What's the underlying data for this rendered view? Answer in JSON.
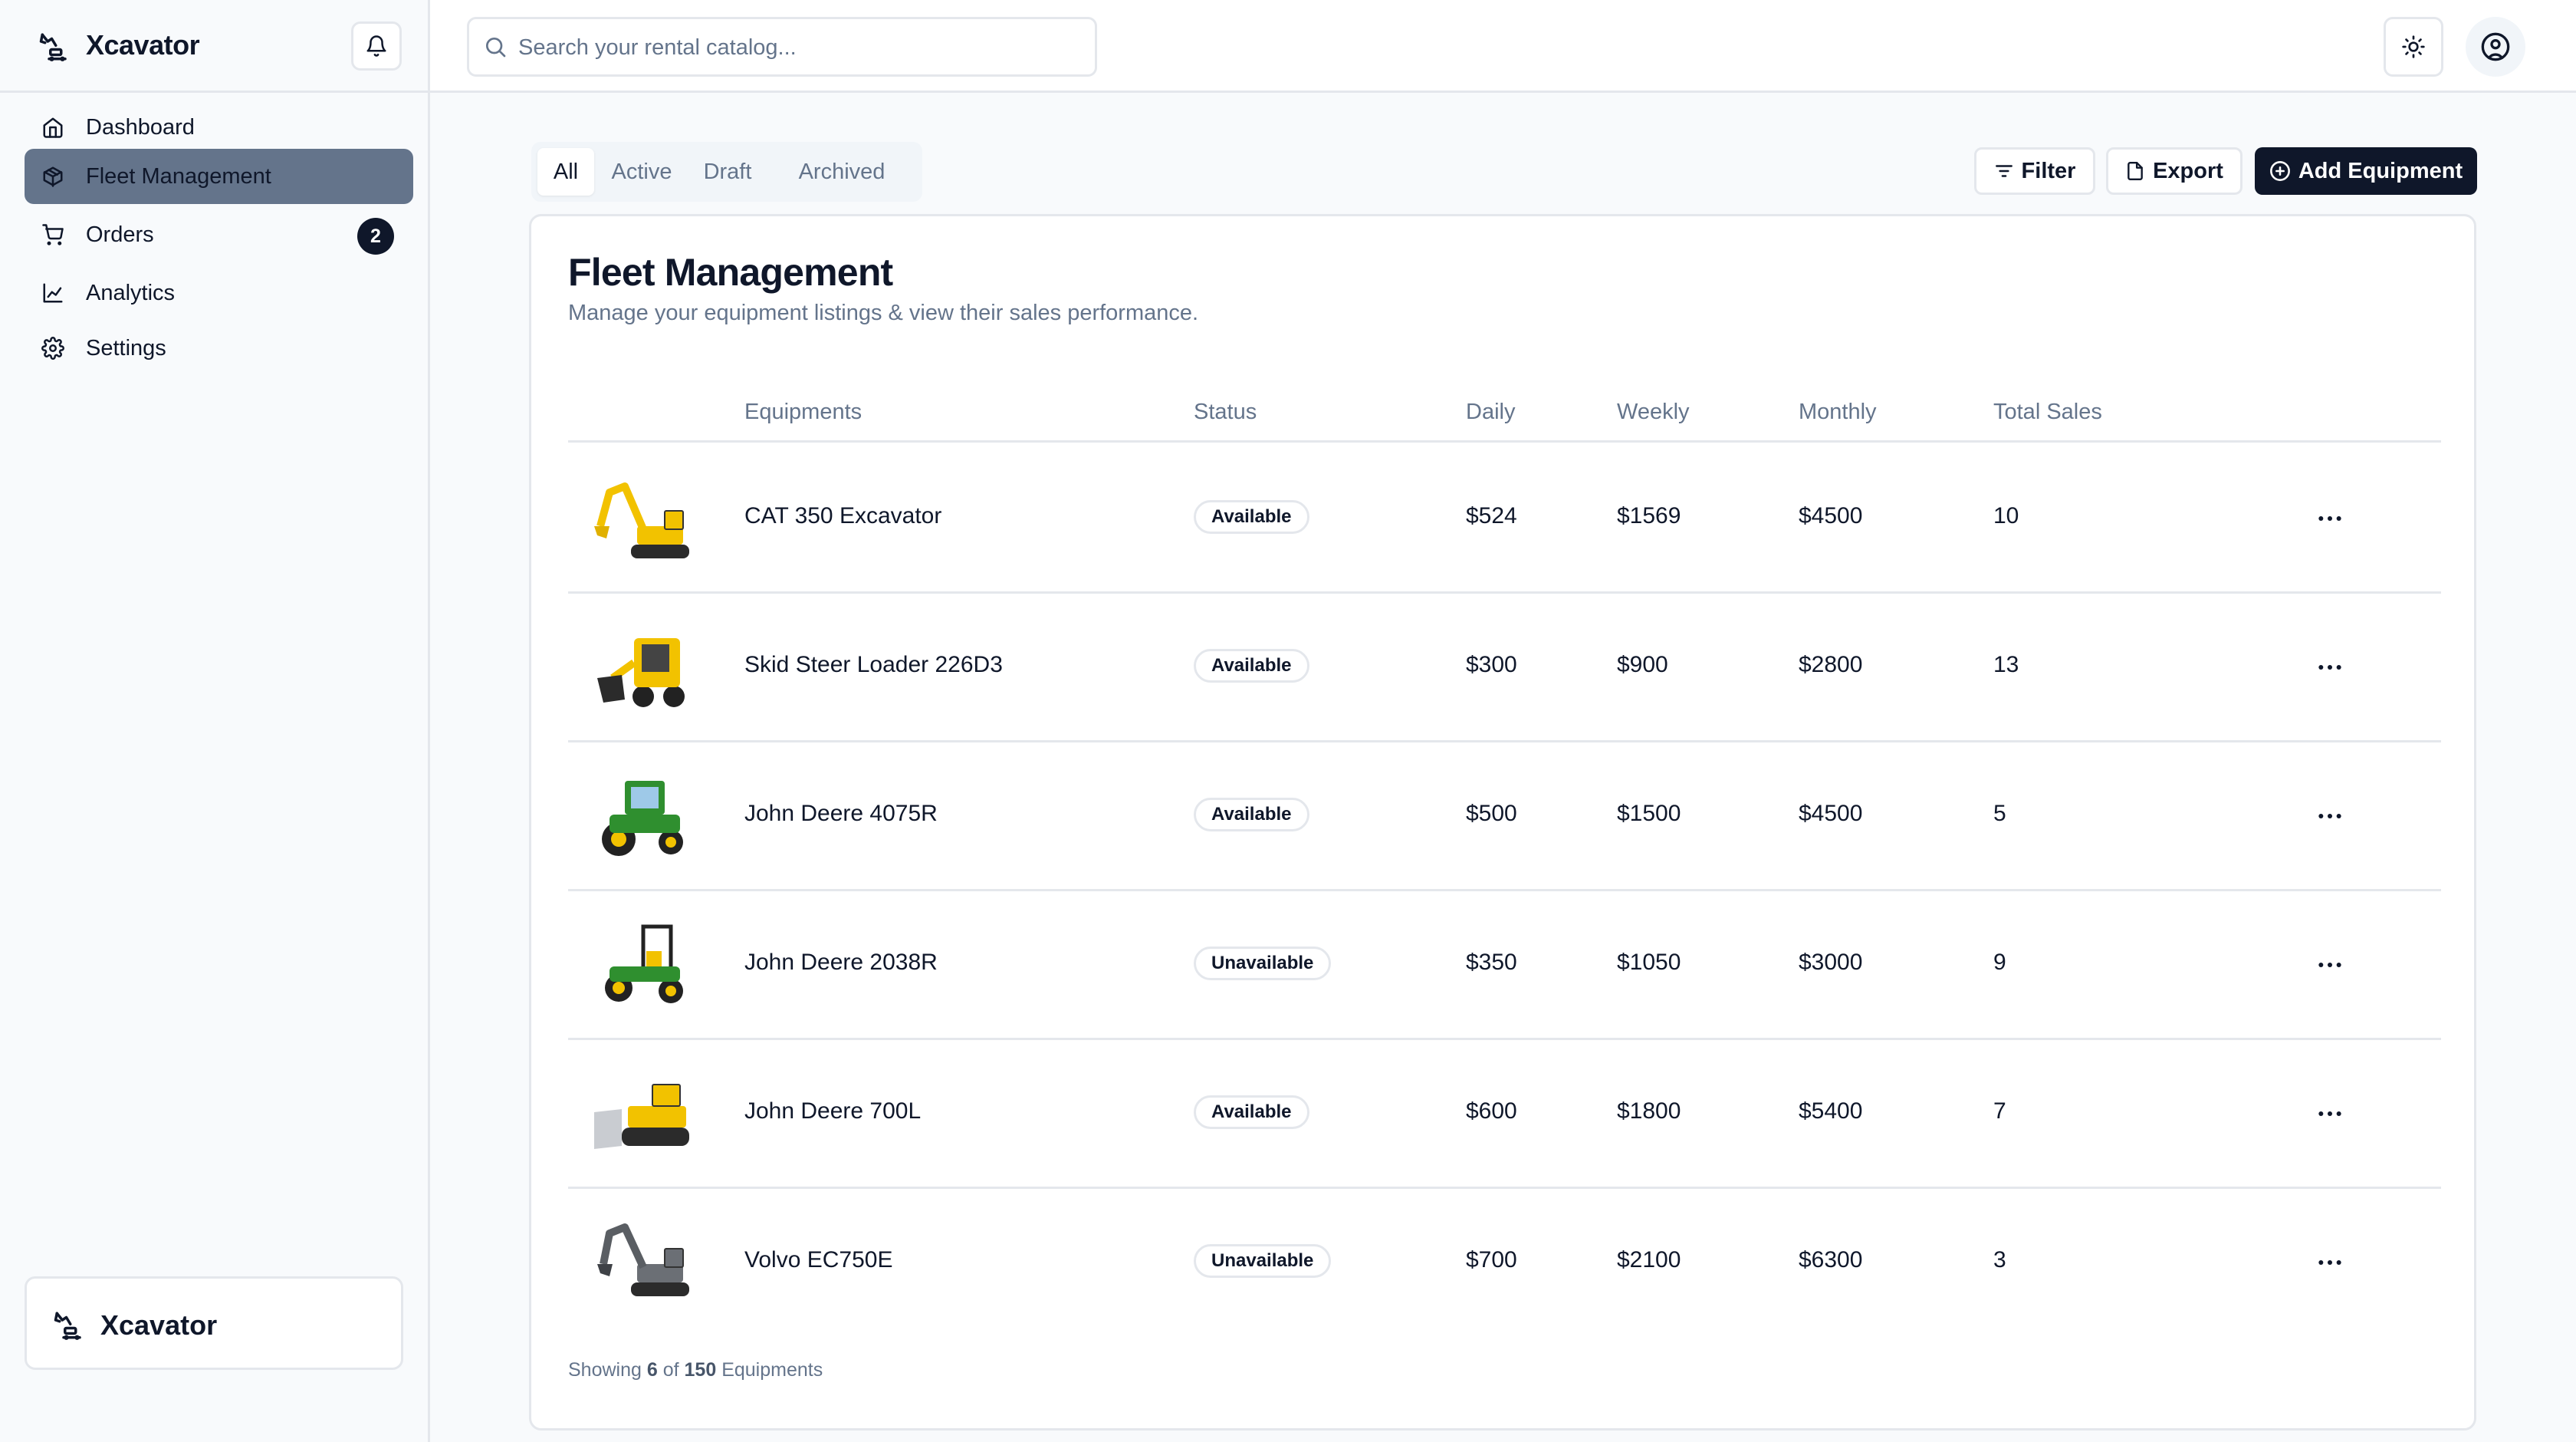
{
  "app": {
    "name": "Xcavator"
  },
  "sidebar": {
    "items": [
      {
        "label": "Dashboard",
        "icon": "home-icon",
        "active": false
      },
      {
        "label": "Fleet Management",
        "icon": "package-icon",
        "active": true
      },
      {
        "label": "Orders",
        "icon": "cart-icon",
        "active": false,
        "badge": "2"
      },
      {
        "label": "Analytics",
        "icon": "line-chart-icon",
        "active": false
      },
      {
        "label": "Settings",
        "icon": "gear-icon",
        "active": false
      }
    ],
    "footer_brand": "Xcavator"
  },
  "header": {
    "search_placeholder": "Search your rental catalog..."
  },
  "tabs": [
    "All",
    "Active",
    "Draft",
    "Archived"
  ],
  "toolbar": {
    "filter_label": "Filter",
    "export_label": "Export",
    "add_label": "Add Equipment"
  },
  "card": {
    "title": "Fleet Management",
    "subtitle": "Manage your equipment listings & view their sales performance."
  },
  "table": {
    "columns": [
      "Equipments",
      "Status",
      "Daily",
      "Weekly",
      "Monthly",
      "Total Sales"
    ],
    "rows": [
      {
        "name": "CAT 350 Excavator",
        "status": "Available",
        "daily": "$524",
        "weekly": "$1569",
        "monthly": "$4500",
        "total": "10",
        "thumb": "excavator-yellow"
      },
      {
        "name": "Skid Steer Loader 226D3",
        "status": "Available",
        "daily": "$300",
        "weekly": "$900",
        "monthly": "$2800",
        "total": "13",
        "thumb": "skid-steer"
      },
      {
        "name": "John Deere 4075R",
        "status": "Available",
        "daily": "$500",
        "weekly": "$1500",
        "monthly": "$4500",
        "total": "5",
        "thumb": "tractor-green"
      },
      {
        "name": "John Deere 2038R",
        "status": "Unavailable",
        "daily": "$350",
        "weekly": "$1050",
        "monthly": "$3000",
        "total": "9",
        "thumb": "tractor-green-small"
      },
      {
        "name": "John Deere 700L",
        "status": "Available",
        "daily": "$600",
        "weekly": "$1800",
        "monthly": "$5400",
        "total": "7",
        "thumb": "dozer-yellow"
      },
      {
        "name": "Volvo EC750E",
        "status": "Unavailable",
        "daily": "$700",
        "weekly": "$2100",
        "monthly": "$6300",
        "total": "3",
        "thumb": "excavator-gray"
      }
    ]
  },
  "footer": {
    "prefix": "Showing",
    "shown": "6",
    "of": "of",
    "total": "150",
    "suffix": "Equipments"
  }
}
